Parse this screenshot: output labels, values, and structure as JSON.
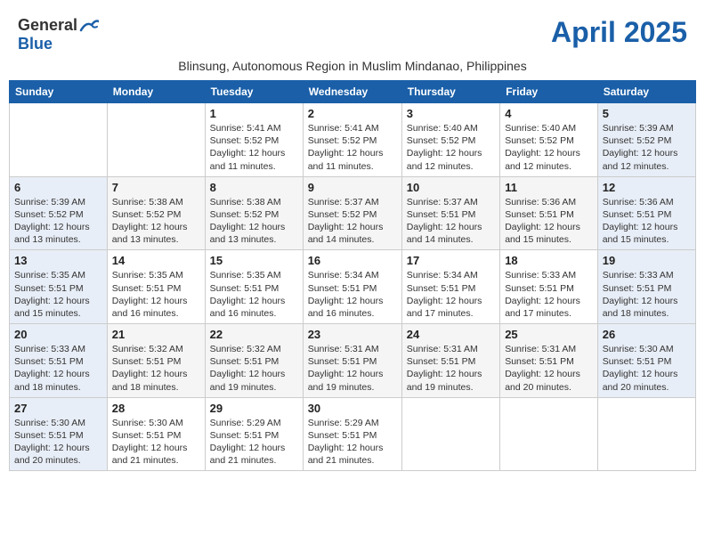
{
  "header": {
    "logo_line1": "General",
    "logo_line2": "Blue",
    "month_title": "April 2025",
    "subtitle": "Blinsung, Autonomous Region in Muslim Mindanao, Philippines"
  },
  "weekdays": [
    "Sunday",
    "Monday",
    "Tuesday",
    "Wednesday",
    "Thursday",
    "Friday",
    "Saturday"
  ],
  "weeks": [
    [
      {
        "day": "",
        "info": ""
      },
      {
        "day": "",
        "info": ""
      },
      {
        "day": "1",
        "info": "Sunrise: 5:41 AM\nSunset: 5:52 PM\nDaylight: 12 hours\nand 11 minutes."
      },
      {
        "day": "2",
        "info": "Sunrise: 5:41 AM\nSunset: 5:52 PM\nDaylight: 12 hours\nand 11 minutes."
      },
      {
        "day": "3",
        "info": "Sunrise: 5:40 AM\nSunset: 5:52 PM\nDaylight: 12 hours\nand 12 minutes."
      },
      {
        "day": "4",
        "info": "Sunrise: 5:40 AM\nSunset: 5:52 PM\nDaylight: 12 hours\nand 12 minutes."
      },
      {
        "day": "5",
        "info": "Sunrise: 5:39 AM\nSunset: 5:52 PM\nDaylight: 12 hours\nand 12 minutes."
      }
    ],
    [
      {
        "day": "6",
        "info": "Sunrise: 5:39 AM\nSunset: 5:52 PM\nDaylight: 12 hours\nand 13 minutes."
      },
      {
        "day": "7",
        "info": "Sunrise: 5:38 AM\nSunset: 5:52 PM\nDaylight: 12 hours\nand 13 minutes."
      },
      {
        "day": "8",
        "info": "Sunrise: 5:38 AM\nSunset: 5:52 PM\nDaylight: 12 hours\nand 13 minutes."
      },
      {
        "day": "9",
        "info": "Sunrise: 5:37 AM\nSunset: 5:52 PM\nDaylight: 12 hours\nand 14 minutes."
      },
      {
        "day": "10",
        "info": "Sunrise: 5:37 AM\nSunset: 5:51 PM\nDaylight: 12 hours\nand 14 minutes."
      },
      {
        "day": "11",
        "info": "Sunrise: 5:36 AM\nSunset: 5:51 PM\nDaylight: 12 hours\nand 15 minutes."
      },
      {
        "day": "12",
        "info": "Sunrise: 5:36 AM\nSunset: 5:51 PM\nDaylight: 12 hours\nand 15 minutes."
      }
    ],
    [
      {
        "day": "13",
        "info": "Sunrise: 5:35 AM\nSunset: 5:51 PM\nDaylight: 12 hours\nand 15 minutes."
      },
      {
        "day": "14",
        "info": "Sunrise: 5:35 AM\nSunset: 5:51 PM\nDaylight: 12 hours\nand 16 minutes."
      },
      {
        "day": "15",
        "info": "Sunrise: 5:35 AM\nSunset: 5:51 PM\nDaylight: 12 hours\nand 16 minutes."
      },
      {
        "day": "16",
        "info": "Sunrise: 5:34 AM\nSunset: 5:51 PM\nDaylight: 12 hours\nand 16 minutes."
      },
      {
        "day": "17",
        "info": "Sunrise: 5:34 AM\nSunset: 5:51 PM\nDaylight: 12 hours\nand 17 minutes."
      },
      {
        "day": "18",
        "info": "Sunrise: 5:33 AM\nSunset: 5:51 PM\nDaylight: 12 hours\nand 17 minutes."
      },
      {
        "day": "19",
        "info": "Sunrise: 5:33 AM\nSunset: 5:51 PM\nDaylight: 12 hours\nand 18 minutes."
      }
    ],
    [
      {
        "day": "20",
        "info": "Sunrise: 5:33 AM\nSunset: 5:51 PM\nDaylight: 12 hours\nand 18 minutes."
      },
      {
        "day": "21",
        "info": "Sunrise: 5:32 AM\nSunset: 5:51 PM\nDaylight: 12 hours\nand 18 minutes."
      },
      {
        "day": "22",
        "info": "Sunrise: 5:32 AM\nSunset: 5:51 PM\nDaylight: 12 hours\nand 19 minutes."
      },
      {
        "day": "23",
        "info": "Sunrise: 5:31 AM\nSunset: 5:51 PM\nDaylight: 12 hours\nand 19 minutes."
      },
      {
        "day": "24",
        "info": "Sunrise: 5:31 AM\nSunset: 5:51 PM\nDaylight: 12 hours\nand 19 minutes."
      },
      {
        "day": "25",
        "info": "Sunrise: 5:31 AM\nSunset: 5:51 PM\nDaylight: 12 hours\nand 20 minutes."
      },
      {
        "day": "26",
        "info": "Sunrise: 5:30 AM\nSunset: 5:51 PM\nDaylight: 12 hours\nand 20 minutes."
      }
    ],
    [
      {
        "day": "27",
        "info": "Sunrise: 5:30 AM\nSunset: 5:51 PM\nDaylight: 12 hours\nand 20 minutes."
      },
      {
        "day": "28",
        "info": "Sunrise: 5:30 AM\nSunset: 5:51 PM\nDaylight: 12 hours\nand 21 minutes."
      },
      {
        "day": "29",
        "info": "Sunrise: 5:29 AM\nSunset: 5:51 PM\nDaylight: 12 hours\nand 21 minutes."
      },
      {
        "day": "30",
        "info": "Sunrise: 5:29 AM\nSunset: 5:51 PM\nDaylight: 12 hours\nand 21 minutes."
      },
      {
        "day": "",
        "info": ""
      },
      {
        "day": "",
        "info": ""
      },
      {
        "day": "",
        "info": ""
      }
    ]
  ]
}
